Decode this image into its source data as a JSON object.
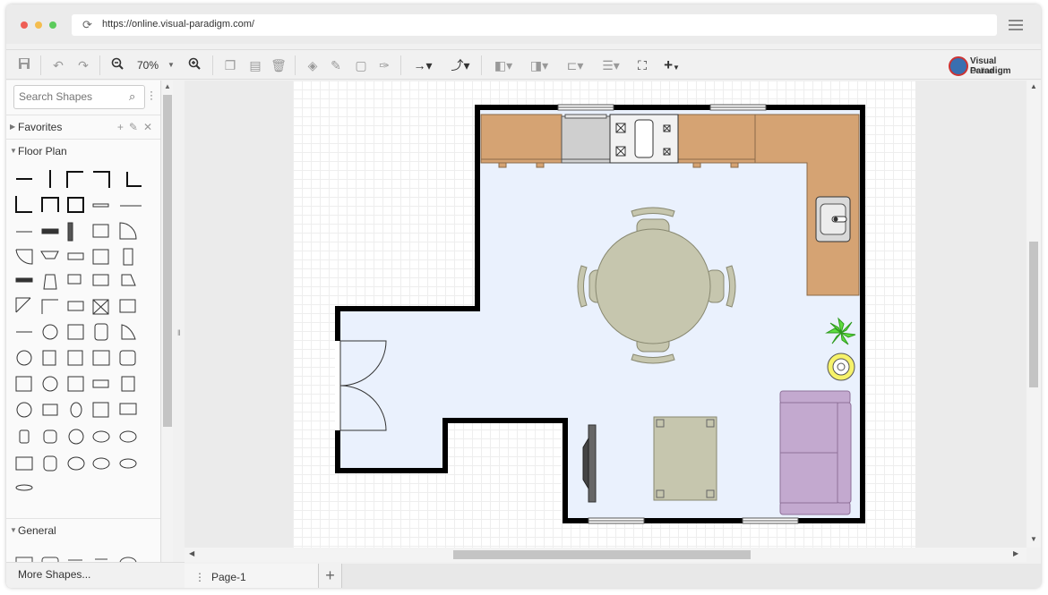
{
  "browser": {
    "url": "https://online.visual-paradigm.com/",
    "traffic_lights": [
      "#ee5e55",
      "#f4bd4f",
      "#5ccb5c"
    ]
  },
  "toolbar": {
    "zoom": "70%",
    "brand_line1": "Visual Paradigm",
    "brand_line2": "Online"
  },
  "sidebar": {
    "search_placeholder": "Search Shapes",
    "sections": [
      {
        "label": "Favorites",
        "expanded": false
      },
      {
        "label": "Floor Plan",
        "expanded": true
      },
      {
        "label": "General",
        "expanded": true
      }
    ],
    "more_shapes": "More Shapes..."
  },
  "pages": {
    "tabs": [
      "Page-1"
    ]
  },
  "colors": {
    "floor": "#eaf1fd",
    "wall": "#000000",
    "counter": "#d5a373",
    "table": "#c6c6ae",
    "sofa": "#c3a9cf",
    "plant": "#5fdd3f",
    "accent_logo": "#3a6fb0"
  }
}
